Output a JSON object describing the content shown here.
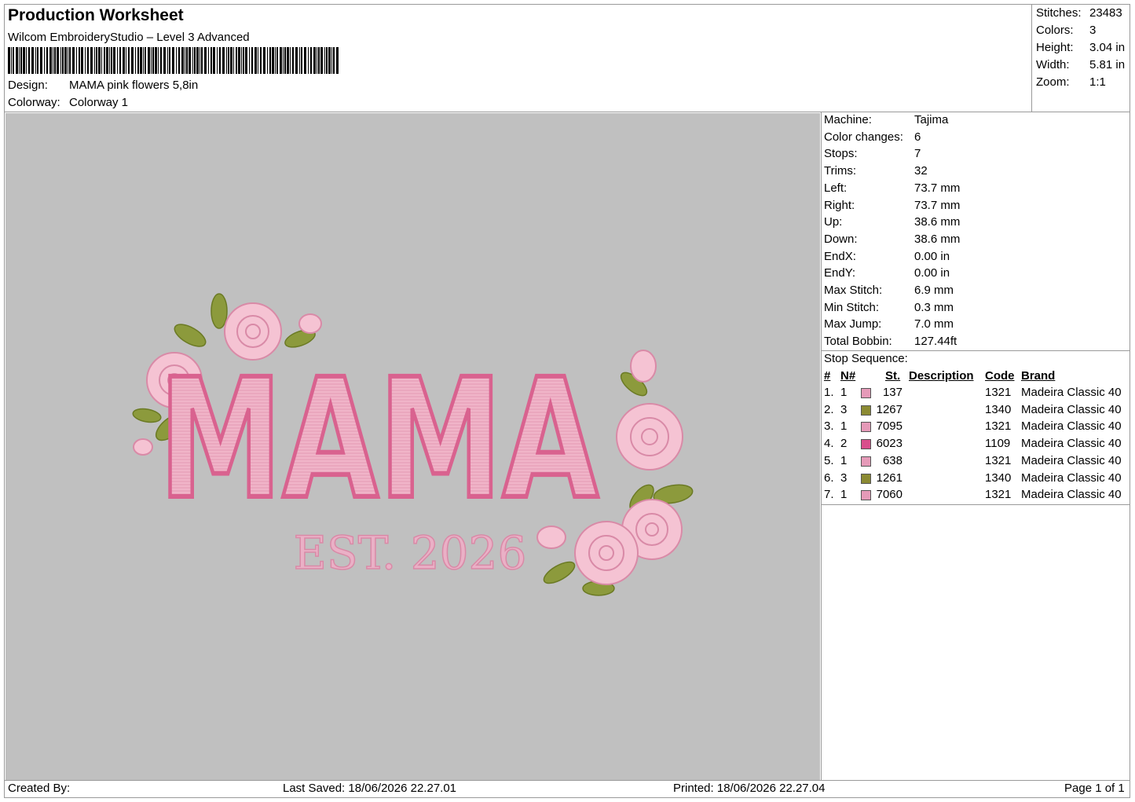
{
  "header": {
    "title": "Production Worksheet",
    "software": "Wilcom EmbroideryStudio – Level 3 Advanced",
    "design_label": "Design:",
    "design_value": "MAMA pink flowers 5,8in",
    "colorway_label": "Colorway:",
    "colorway_value": "Colorway 1"
  },
  "summary": [
    {
      "label": "Stitches:",
      "value": "23483"
    },
    {
      "label": "Colors:",
      "value": "3"
    },
    {
      "label": "Height:",
      "value": "3.04 in"
    },
    {
      "label": "Width:",
      "value": "5.81 in"
    },
    {
      "label": "Zoom:",
      "value": "1:1"
    }
  ],
  "machine_info": [
    {
      "label": "Machine:",
      "value": "Tajima"
    },
    {
      "label": "Color changes:",
      "value": "6"
    },
    {
      "label": "Stops:",
      "value": "7"
    },
    {
      "label": "Trims:",
      "value": "32"
    },
    {
      "label": "Left:",
      "value": "73.7 mm"
    },
    {
      "label": "Right:",
      "value": "73.7 mm"
    },
    {
      "label": "Up:",
      "value": "38.6 mm"
    },
    {
      "label": "Down:",
      "value": "38.6 mm"
    },
    {
      "label": "EndX:",
      "value": "0.00 in"
    },
    {
      "label": "EndY:",
      "value": "0.00 in"
    },
    {
      "label": "Max Stitch:",
      "value": "6.9 mm"
    },
    {
      "label": "Min Stitch:",
      "value": "0.3 mm"
    },
    {
      "label": "Max Jump:",
      "value": "7.0 mm"
    },
    {
      "label": "Total Bobbin:",
      "value": "127.44ft"
    }
  ],
  "stop_sequence": {
    "title": "Stop Sequence:",
    "headers": {
      "num": "#",
      "n": "N#",
      "st": "St.",
      "description": "Description",
      "code": "Code",
      "brand": "Brand"
    },
    "rows": [
      {
        "num": "1.",
        "n": "1",
        "color": "#e59ab8",
        "st": "137",
        "code": "1321",
        "brand": "Madeira Classic 40"
      },
      {
        "num": "2.",
        "n": "3",
        "color": "#8b8a32",
        "st": "1267",
        "code": "1340",
        "brand": "Madeira Classic 40"
      },
      {
        "num": "3.",
        "n": "1",
        "color": "#e59ab8",
        "st": "7095",
        "code": "1321",
        "brand": "Madeira Classic 40"
      },
      {
        "num": "4.",
        "n": "2",
        "color": "#d94f8c",
        "st": "6023",
        "code": "1109",
        "brand": "Madeira Classic 40"
      },
      {
        "num": "5.",
        "n": "1",
        "color": "#e59ab8",
        "st": "638",
        "code": "1321",
        "brand": "Madeira Classic 40"
      },
      {
        "num": "6.",
        "n": "3",
        "color": "#8b8a32",
        "st": "1261",
        "code": "1340",
        "brand": "Madeira Classic 40"
      },
      {
        "num": "7.",
        "n": "1",
        "color": "#e59ab8",
        "st": "7060",
        "code": "1321",
        "brand": "Madeira Classic 40"
      }
    ]
  },
  "design_preview": {
    "main_text": "MAMA",
    "sub_text": "EST. 2026",
    "fill_color": "#f2b9cc",
    "outline_color": "#d9628f",
    "leaf_color": "#8c9a3c",
    "rose_color": "#f5c3d3"
  },
  "footer": {
    "created_by": "Created By:",
    "last_saved": "Last Saved: 18/06/2026 22.27.01",
    "printed": "Printed: 18/06/2026 22.27.04",
    "page": "Page 1 of 1"
  }
}
